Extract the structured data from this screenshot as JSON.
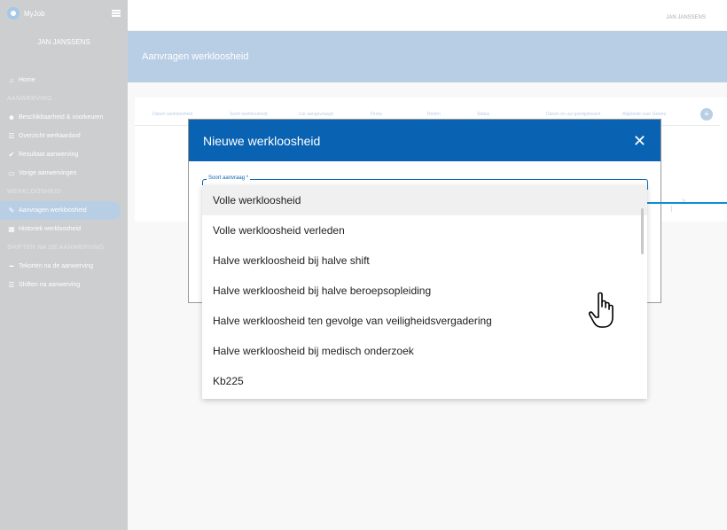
{
  "sidebar": {
    "app_name": "MyJob",
    "user_name": "JAN JANSSENS",
    "home": "Home",
    "section_aanwerving": "AANWERVING",
    "beschikbaarheid": "Beschikbaarheid & voorkeuren",
    "overzicht": "Overzicht werkaanbod",
    "resultaat": "Resultaat aanwerving",
    "vorige": "Vorige aanwervingen",
    "section_werkloosheid": "WERKLOOSHEID",
    "aanvragen": "Aanvragen werkloosheid",
    "historiek": "Historiek werkloosheid",
    "section_shiften": "SHIFTEN NA DE AANWERVING",
    "tekorten": "Tekorten na de aanwerving",
    "shiften": "Shiften na aanwerving"
  },
  "topbar": {
    "user_name": "JAN JANSSENS"
  },
  "banner": {
    "title": "Aanvragen werkloosheid"
  },
  "table": {
    "columns": [
      "Datum werkloosheid",
      "Soort werkloosheid",
      "Uur aangevraagd",
      "Firma",
      "Reden",
      "Status",
      "Datum en uur goedgekeurd",
      "Afgeleide naar Gewez"
    ],
    "pager": "< > >|"
  },
  "modal": {
    "title": "Nieuwe werkloosheid",
    "close": "✕",
    "field_label": "Soort aanvraag *"
  },
  "dropdown": {
    "options": [
      "Volle werkloosheid",
      "Volle werkloosheid verleden",
      "Halve werkloosheid bij halve shift",
      "Halve werkloosheid bij halve beroepsopleiding",
      "Halve werkloosheid ten gevolge van veiligheidsvergadering",
      "Halve werkloosheid bij medisch onderzoek",
      "Kb225"
    ]
  },
  "colors": {
    "sidebar": "#a3a6a9",
    "banner": "#7fa6cf",
    "modal_header": "#0a63b2"
  },
  "icons": [
    "home-icon",
    "user-plus-icon",
    "list-icon",
    "check-icon",
    "inbox-icon",
    "request-icon",
    "calendar-icon",
    "minus-icon",
    "list-icon",
    "plus-icon",
    "close-icon",
    "hand-cursor-icon"
  ]
}
